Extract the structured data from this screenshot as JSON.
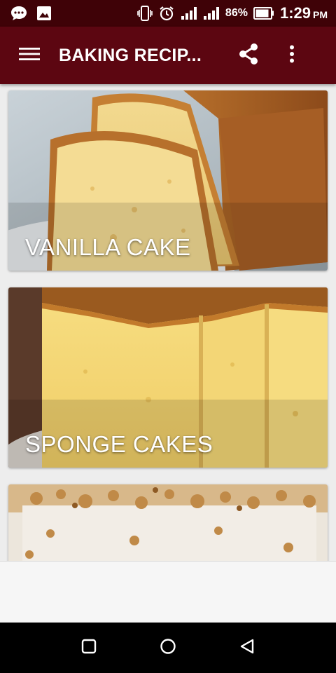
{
  "status_bar": {
    "battery_percent": "86%",
    "time": "1:29",
    "ampm": "PM",
    "icons": [
      "message-bubble-icon",
      "image-icon",
      "vibrate-icon",
      "alarm-icon",
      "signal-icon",
      "signal-icon-2",
      "battery-icon"
    ]
  },
  "app_bar": {
    "title": "BAKING RECIP...",
    "icons": [
      "menu-icon",
      "share-icon",
      "more-vert-icon"
    ]
  },
  "cards": [
    {
      "title": "VANILLA CAKE"
    },
    {
      "title": "SPONGE CAKES"
    },
    {
      "title": ""
    }
  ],
  "nav_bar": {
    "icons": [
      "recents-square-icon",
      "home-circle-icon",
      "back-triangle-icon"
    ]
  },
  "colors": {
    "status_bar": "#3f0207",
    "app_bar": "#5c0611",
    "background": "#ededed"
  }
}
